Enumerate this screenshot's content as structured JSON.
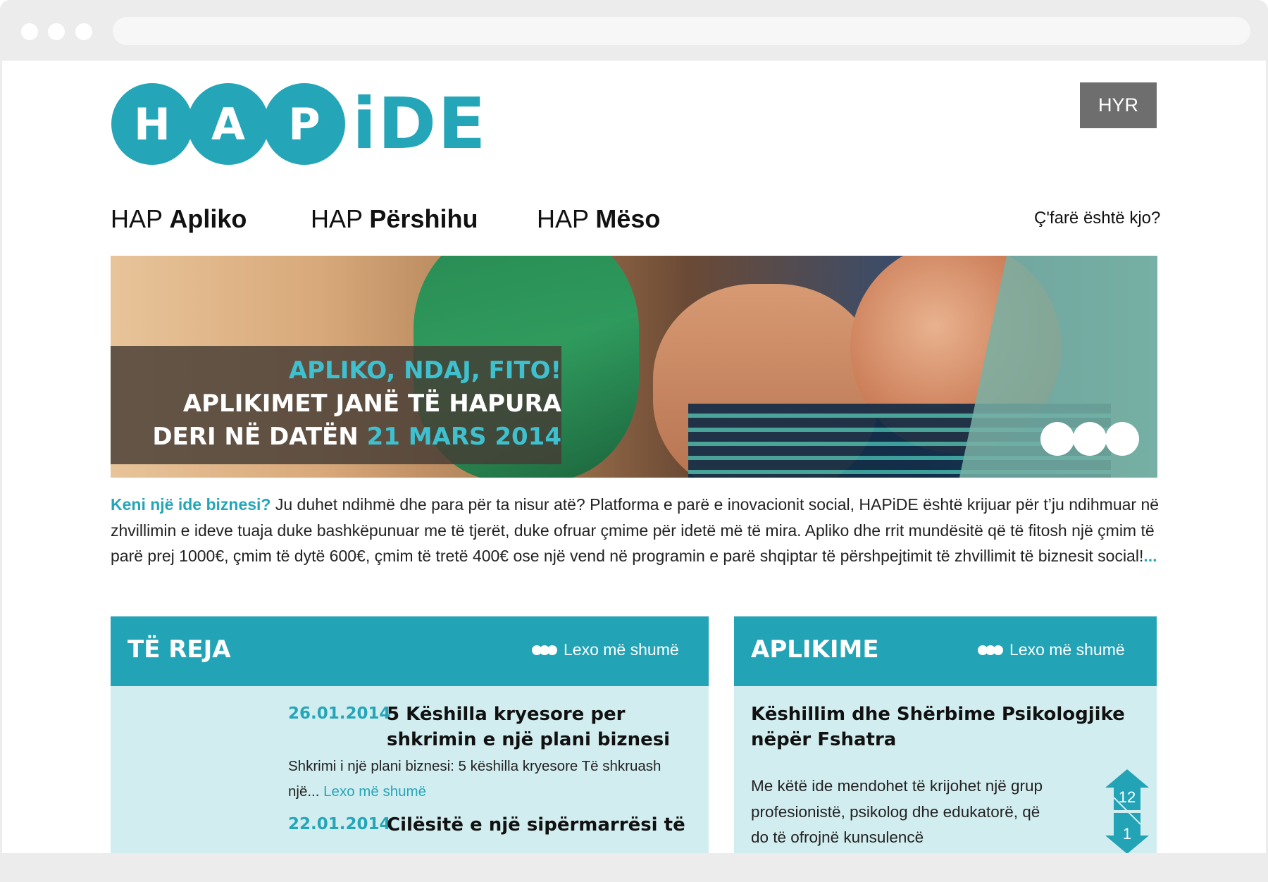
{
  "browser": {
    "window_dots": 3
  },
  "header": {
    "logo_letters": [
      "H",
      "A",
      "P"
    ],
    "logo_text": "iDE",
    "login_label": "HYR"
  },
  "nav": {
    "items": [
      {
        "prefix": "HAP",
        "label": "Apliko"
      },
      {
        "prefix": "HAP",
        "label": "Përshihu"
      },
      {
        "prefix": "HAP",
        "label": "Mëso"
      }
    ],
    "help_label": "Ç'farë është kjo?"
  },
  "hero": {
    "line1": "APLIKO, NDAJ, FITO!",
    "line2": "APLIKIMET JANË TË HAPURA",
    "line3_prefix": "DERI NË DATËN",
    "line3_date": "21 MARS 2014",
    "slide_dots": 3
  },
  "intro": {
    "lead": "Keni një ide biznesi?",
    "body": "Ju duhet ndihmë dhe para për ta nisur atë? Platforma e parë e inovacionit social, HAPiDE është krijuar për t’ju ndihmuar në zhvillimin e ideve tuaja duke bashkëpunuar me të tjerët, duke ofruar çmime për idetë më të mira. Apliko dhe rrit mundësitë që të fitosh një çmim të parë prej 1000€, çmim të dytë 600€, çmim të tretë 400€ ose një vend në programin e parë shqiptar të përshpejtimit të zhvillimit të biznesit social!",
    "more": "..."
  },
  "news": {
    "title": "TË REJA",
    "more_label": "Lexo më shumë",
    "items": [
      {
        "date": "26.01.2014",
        "title": "5 Këshilla kryesore per shkrimin e një plani biznesi",
        "excerpt": "Shkrimi i një plani biznesi: 5 këshilla kryesore Të shkruash një...",
        "link": "Lexo më shumë"
      },
      {
        "date": "22.01.2014",
        "title": "Cilësitë e një sipërmarrësi të",
        "excerpt": "",
        "link": ""
      }
    ]
  },
  "applications": {
    "title": "APLIKIME",
    "more_label": "Lexo më shumë",
    "item": {
      "title": "Këshillim dhe Shërbime Psikologjike nëpër Fshatra",
      "text": "Me këtë ide mendohet të krijohet një grup profesionistë, psikolog dhe edukatorë, që do të ofrojnë kunsulencë",
      "votes_up": "12",
      "votes_down": "1"
    }
  },
  "colors": {
    "accent": "#25a6b8",
    "panel_header": "#22a3b6",
    "panel_body": "#d2edf0",
    "login_bg": "#6e6e6e"
  }
}
